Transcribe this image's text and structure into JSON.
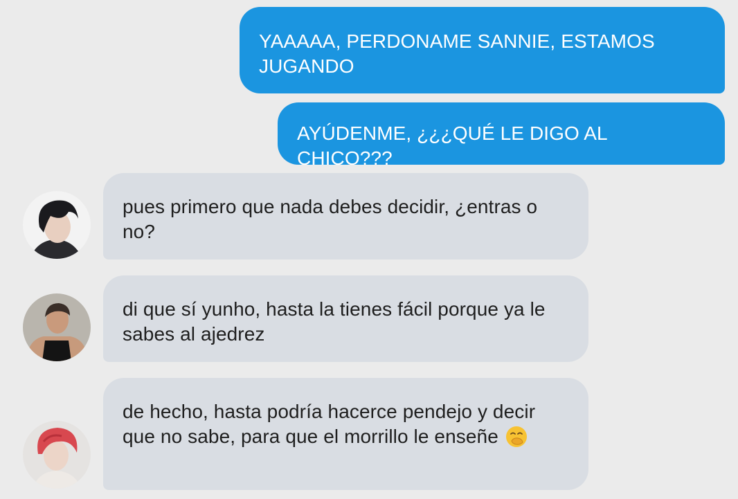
{
  "messages": [
    {
      "side": "sent",
      "text": "YAAAAA, PERDONAME SANNIE, ESTAMOS JUGANDO"
    },
    {
      "side": "sent",
      "text": "AYÚDENME, ¿¿¿QUÉ LE DIGO AL CHICO???"
    },
    {
      "side": "received",
      "avatar": "avatar-dark-hair-portrait",
      "text": "pues primero que nada debes decidir, ¿entras o no?"
    },
    {
      "side": "received",
      "avatar": "avatar-tank-top-portrait",
      "text": "di que sí yunho, hasta la tienes fácil porque ya le sabes al ajedrez"
    },
    {
      "side": "received",
      "avatar": "avatar-red-hair-portrait",
      "text": "de hecho, hasta podría hacerce pendejo y decir que no sabe, para que el morrillo le enseñe",
      "emoji": "face-with-hand-over-mouth-icon"
    }
  ],
  "colors": {
    "background": "#ebebeb",
    "sent_bubble": "#1b95e0",
    "received_bubble": "#d9dde3",
    "received_text": "#1e1e1e"
  }
}
